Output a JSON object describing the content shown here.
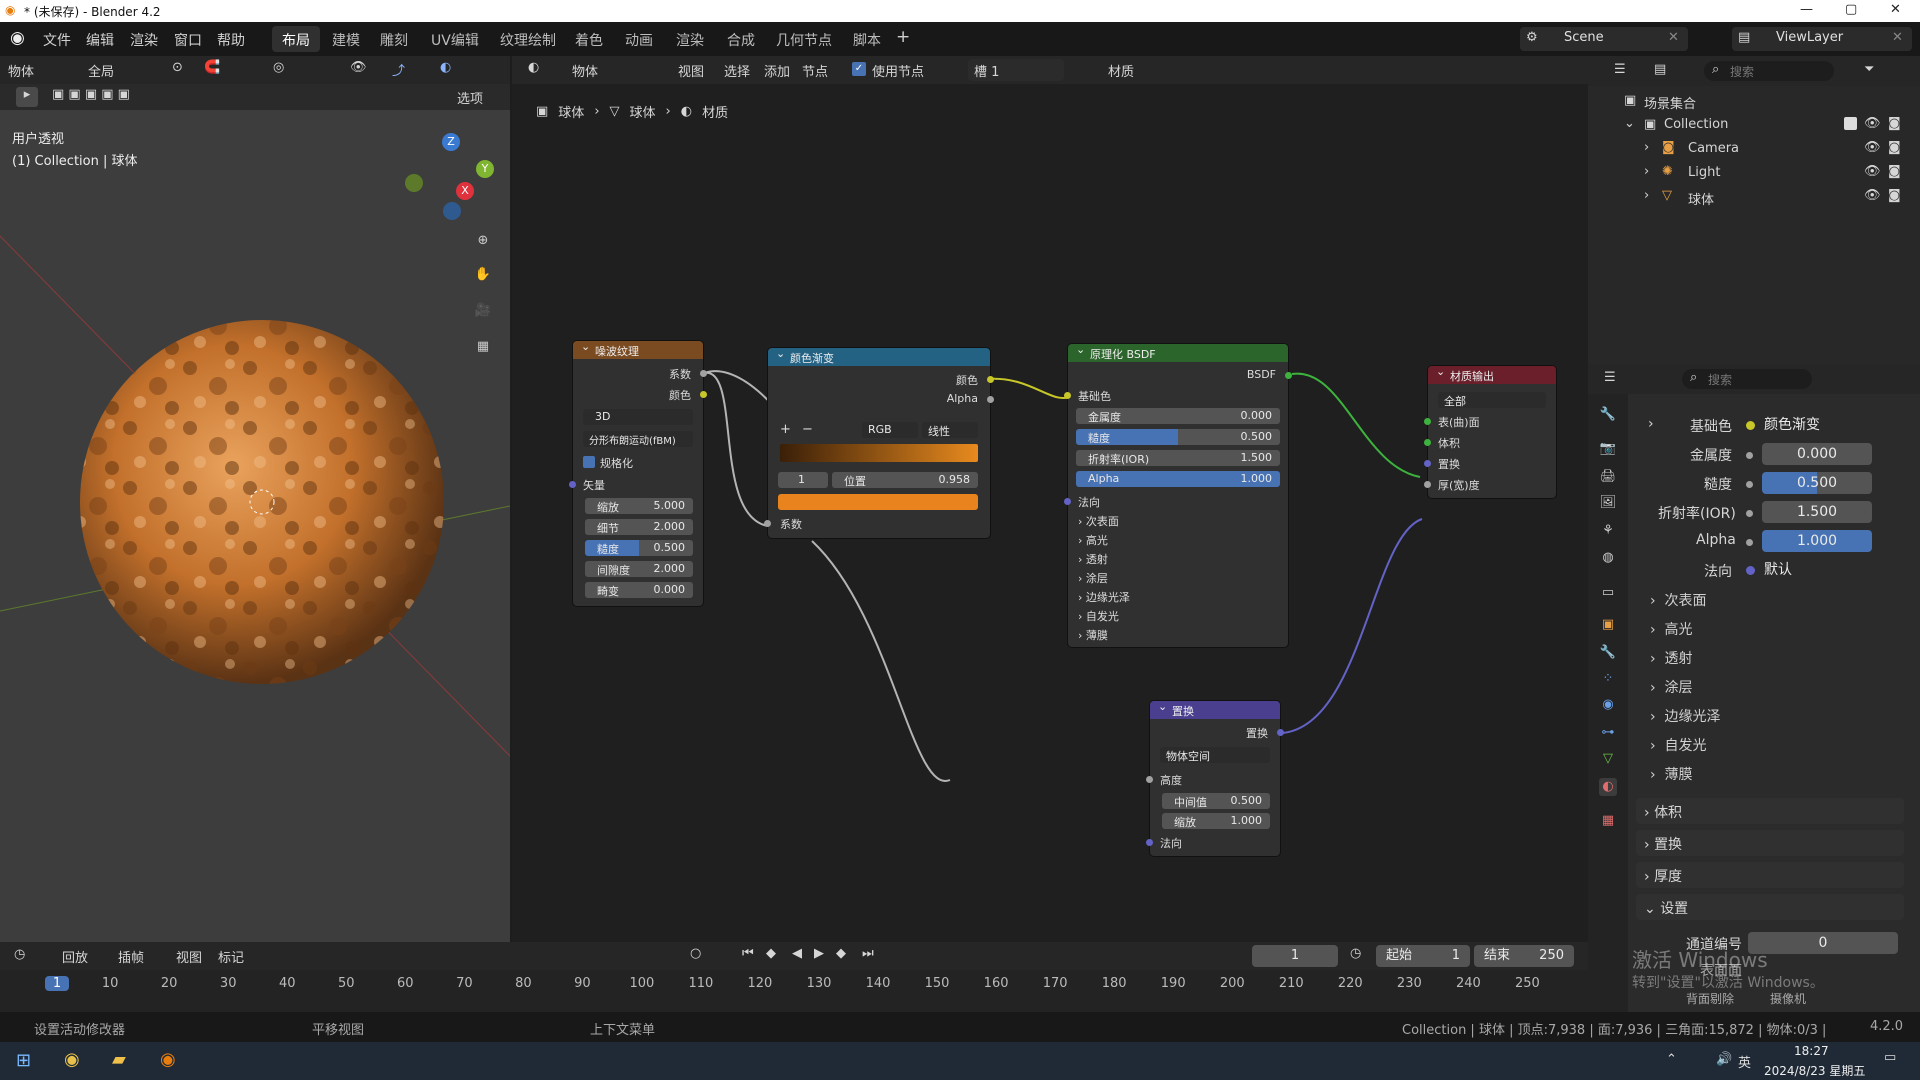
{
  "window": {
    "title": "* (未保存) - Blender 4.2"
  },
  "menubar": {
    "menus": [
      "文件",
      "编辑",
      "渲染",
      "窗口",
      "帮助"
    ],
    "workspaces": [
      "布局",
      "建模",
      "雕刻",
      "UV编辑",
      "纹理绘制",
      "着色",
      "动画",
      "渲染",
      "合成",
      "几何节点",
      "脚本"
    ],
    "active_workspace": "布局",
    "scene": "Scene",
    "view_layer": "ViewLayer"
  },
  "viewport": {
    "mode": "物体",
    "global": "全局",
    "options": "选项",
    "view_name": "用户透视",
    "collection_label": "(1) Collection | 球体",
    "gizmo": {
      "x": "X",
      "y": "Y",
      "z": "Z"
    }
  },
  "node_editor": {
    "header": {
      "mode": "物体",
      "view": "视图",
      "select": "选择",
      "add": "添加",
      "node": "节点",
      "use_nodes": "使用节点",
      "slot": "槽 1",
      "material": "材质"
    },
    "breadcrumb": [
      "球体",
      "球体",
      "材质"
    ],
    "noise_node": {
      "title": "噪波纹理",
      "out_fac": "系数",
      "out_color": "颜色",
      "dim": "3D",
      "type": "分形布朗运动(fBM)",
      "normalize": "规格化",
      "vector": "矢量",
      "fields": [
        {
          "label": "缩放",
          "value": "5.000"
        },
        {
          "label": "细节",
          "value": "2.000"
        },
        {
          "label": "糙度",
          "value": "0.500"
        },
        {
          "label": "间隙度",
          "value": "2.000"
        },
        {
          "label": "畸变",
          "value": "0.000"
        }
      ]
    },
    "ramp_node": {
      "title": "颜色渐变",
      "out_color": "颜色",
      "out_alpha": "Alpha",
      "mode": "RGB",
      "interp": "线性",
      "stop_index": "1",
      "pos_label": "位置",
      "pos_value": "0.958",
      "in_fac": "系数"
    },
    "bsdf_node": {
      "title": "原理化 BSDF",
      "out": "BSDF",
      "base_color": "基础色",
      "fields": [
        {
          "label": "金属度",
          "value": "0.000"
        },
        {
          "label": "糙度",
          "value": "0.500"
        },
        {
          "label": "折射率(IOR)",
          "value": "1.500"
        },
        {
          "label": "Alpha",
          "value": "1.000"
        }
      ],
      "normal": "法向",
      "sections": [
        "次表面",
        "高光",
        "透射",
        "涂层",
        "边缘光泽",
        "自发光",
        "薄膜"
      ]
    },
    "output_node": {
      "title": "材质输出",
      "target": "全部",
      "inputs": [
        "表(曲)面",
        "体积",
        "置换",
        "厚(宽)度"
      ]
    },
    "disp_node": {
      "title": "置换",
      "out": "置换",
      "space": "物体空间",
      "height": "高度",
      "fields": [
        {
          "label": "中间值",
          "value": "0.500"
        },
        {
          "label": "缩放",
          "value": "1.000"
        }
      ],
      "normal": "法向"
    }
  },
  "outliner": {
    "root": "场景集合",
    "collection": "Collection",
    "items": [
      "Camera",
      "Light",
      "球体"
    ],
    "search_placeholder": "搜索"
  },
  "properties": {
    "search_placeholder": "搜索",
    "base_color_label": "基础色",
    "base_color_value": "颜色渐变",
    "rows": [
      {
        "label": "金属度",
        "value": "0.000"
      },
      {
        "label": "糙度",
        "value": "0.500"
      },
      {
        "label": "折射率(IOR)",
        "value": "1.500"
      },
      {
        "label": "Alpha",
        "value": "1.000"
      }
    ],
    "normal_label": "法向",
    "normal_value": "默认",
    "sections": [
      "次表面",
      "高光",
      "透射",
      "涂层",
      "边缘光泽",
      "自发光",
      "薄膜"
    ],
    "panels": [
      "体积",
      "置换",
      "厚度",
      "设置"
    ],
    "pass_index_label": "通道编号",
    "pass_index_value": "0",
    "backface_label": "背面剔除",
    "camera_label": "摄像机",
    "surface_label": "表面面",
    "watermark_title": "激活 Windows",
    "watermark_sub": "转到\"设置\"以激活 Windows。"
  },
  "timeline": {
    "playback": "回放",
    "keying": "插帧",
    "view": "视图",
    "marker": "标记",
    "current_frame": "1",
    "start_label": "起始",
    "start": "1",
    "end_label": "结束",
    "end": "250",
    "ticks": [
      "1",
      "10",
      "20",
      "30",
      "40",
      "50",
      "60",
      "70",
      "80",
      "90",
      "100",
      "110",
      "120",
      "130",
      "140",
      "150",
      "160",
      "170",
      "180",
      "190",
      "200",
      "210",
      "220",
      "230",
      "240",
      "250"
    ]
  },
  "statusbar": {
    "left": "设置活动修改器",
    "pan": "平移视图",
    "context": "上下文菜单",
    "stats": "Collection | 球体 | 顶点:7,938 | 面:7,936 | 三角面:15,872 | 物体:0/3 |",
    "version": "4.2.0"
  },
  "taskbar": {
    "time": "18:27",
    "date": "2024/8/23 星期五",
    "ime": "英"
  },
  "colors": {
    "accent": "#4772b3",
    "noise_header": "#7a4a20",
    "ramp_header": "#246283",
    "bsdf_header": "#2b652b",
    "output_header": "#6a1f2a",
    "disp_header": "#4a3e8f"
  }
}
